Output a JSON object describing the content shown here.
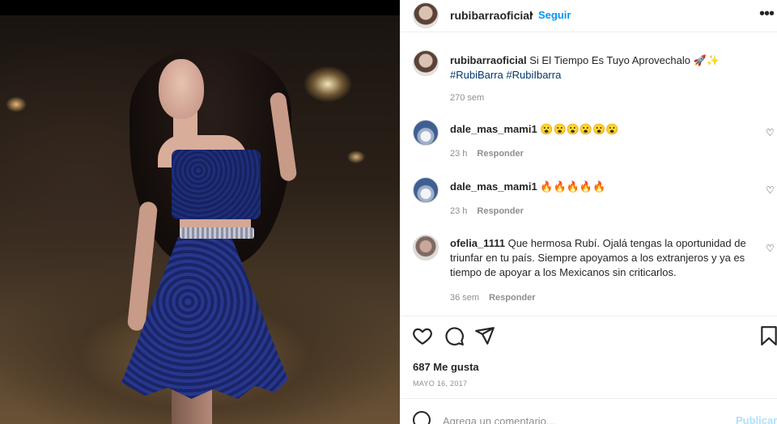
{
  "post": {
    "username": "rubibarraoficial",
    "dot": "•",
    "follow_label": "Seguir",
    "more_label": "•••"
  },
  "caption": {
    "username": "rubibarraoficial",
    "text": "Si El Tiempo Es Tuyo Aprovechalo 🚀✨",
    "hashtags": [
      "#RubiBarra",
      "#RubiIbarra"
    ],
    "time": "270 sem"
  },
  "comments": [
    {
      "username": "dale_mas_mami1",
      "text": "😮😮😮😮😮😮",
      "time": "23 h",
      "reply_label": "Responder"
    },
    {
      "username": "dale_mas_mami1",
      "text": "🔥🔥🔥🔥🔥",
      "time": "23 h",
      "reply_label": "Responder"
    },
    {
      "username": "ofelia_1111",
      "text": "Que hermosa Rubí. Ojalá tengas la oportunidad de triunfar en tu país. Siempre apoyamos a los extranjeros y ya es tiempo de apoyar a los Mexicanos sin criticarlos.",
      "time": "36 sem",
      "reply_label": "Responder"
    }
  ],
  "likes": "687 Me gusta",
  "date": "MAYO 16, 2017",
  "add_comment": {
    "placeholder": "Agrega un comentario...",
    "post_label": "Publicar"
  },
  "icons": {
    "like": "heart-icon",
    "comment": "comment-icon",
    "share": "send-icon",
    "save": "bookmark-icon",
    "more": "more-icon",
    "emoji": "emoji-icon"
  },
  "colors": {
    "link_blue": "#0095f6",
    "hashtag": "#00376b",
    "muted": "#8e8e8e",
    "post_disabled": "#b2dffc"
  }
}
